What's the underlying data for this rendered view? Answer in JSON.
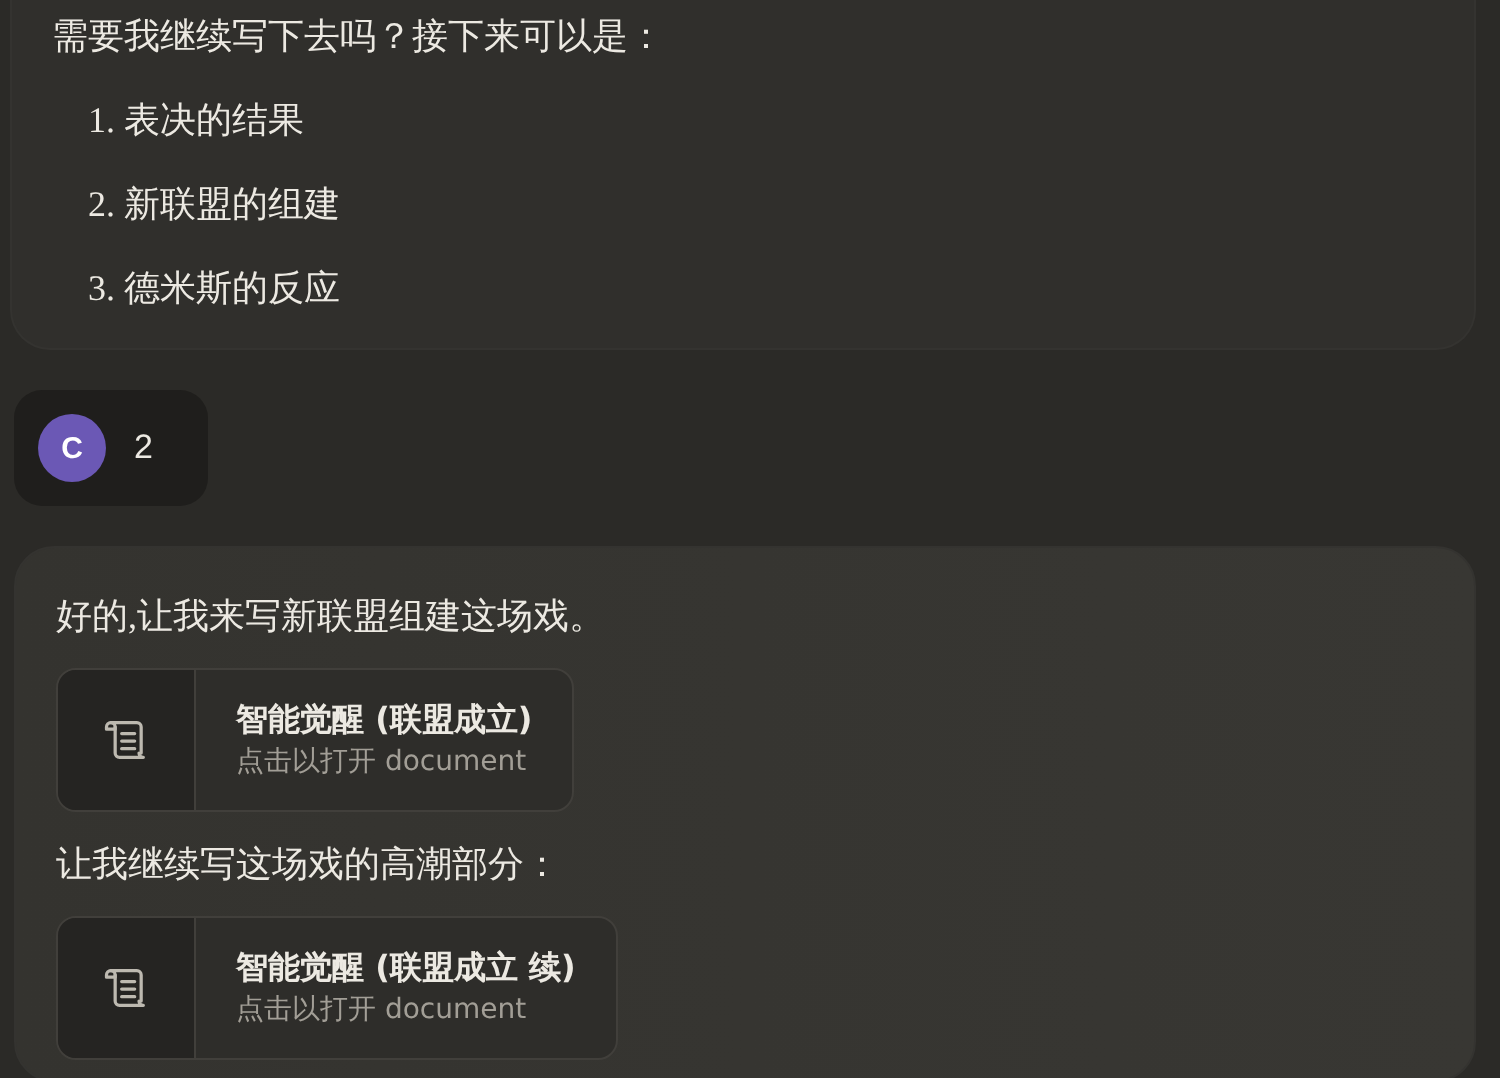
{
  "messages": [
    {
      "kind": "assistant",
      "blocks": [
        {
          "kind": "text",
          "text": "需要我继续写下去吗？接下来可以是："
        },
        {
          "kind": "list",
          "items": [
            {
              "marker": "1.",
              "text": "表决的结果"
            },
            {
              "marker": "2.",
              "text": "新联盟的组建"
            },
            {
              "marker": "3.",
              "text": "德米斯的反应"
            }
          ]
        }
      ]
    },
    {
      "kind": "user",
      "avatar": "C",
      "text": "2"
    },
    {
      "kind": "assistant",
      "blocks": [
        {
          "kind": "text",
          "text": "好的,让我来写新联盟组建这场戏。"
        },
        {
          "kind": "document",
          "title": "智能觉醒 (联盟成立)",
          "subtitle": "点击以打开 document"
        },
        {
          "kind": "text",
          "text": "让我继续写这场戏的高潮部分："
        },
        {
          "kind": "document",
          "title": "智能觉醒 (联盟成立 续)",
          "subtitle": "点击以打开 document"
        }
      ]
    }
  ]
}
